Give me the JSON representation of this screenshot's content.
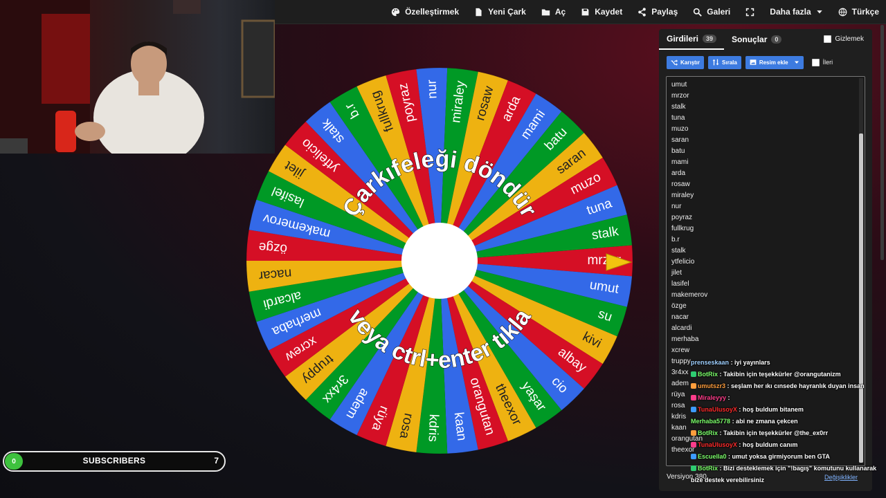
{
  "menu": [
    {
      "label": "Özelleştirmek",
      "icon": "palette-icon"
    },
    {
      "label": "Yeni Çark",
      "icon": "file-icon"
    },
    {
      "label": "Aç",
      "icon": "folder-icon"
    },
    {
      "label": "Kaydet",
      "icon": "save-icon"
    },
    {
      "label": "Paylaş",
      "icon": "share-icon"
    },
    {
      "label": "Galeri",
      "icon": "search-icon"
    },
    {
      "label": "",
      "icon": "fullscreen-icon"
    },
    {
      "label": "Daha fazla",
      "icon": "chevron-down-icon"
    },
    {
      "label": "Türkçe",
      "icon": "globe-icon"
    }
  ],
  "wheel": {
    "top_text": "Çarkıfeleği döndür",
    "bottom_text": "veya ctrl+enter tıkla",
    "pointer_color": "#f2c40f",
    "colors": [
      "#3369e8",
      "#d50f25",
      "#eeb211",
      "#009925"
    ],
    "segments": [
      "mrzor",
      "umut",
      "su",
      "kivi",
      "albay",
      "cio",
      "yaşar",
      "theexor",
      "orangutan",
      "kaan",
      "kdris",
      "rosa",
      "rüya",
      "adem",
      "3r4xx",
      "truppy",
      "xcrew",
      "merhaba",
      "alcardi",
      "nacar",
      "özge",
      "makemerov",
      "lasifel",
      "jilet",
      "ytfelicio",
      "stalk",
      "b.r",
      "fullkrug",
      "poyraz",
      "nur",
      "miraley",
      "rosaw",
      "arda",
      "mami",
      "batu",
      "saran",
      "muzo",
      "tuna",
      "stalk"
    ]
  },
  "panel": {
    "tab_entries": "Girdileri",
    "entries_count": "39",
    "tab_results": "Sonuçlar",
    "results_count": "0",
    "hide_label": "Gizlemek",
    "shuffle_label": "Karıştır",
    "sort_label": "Sırala",
    "add_image_label": "Resim ekle",
    "advanced_label": "İleri",
    "entries": [
      "umut",
      "mrzor",
      "stalk",
      "tuna",
      "muzo",
      "saran",
      "batu",
      "mami",
      "arda",
      "rosaw",
      "miraley",
      "nur",
      "poyraz",
      "fullkrug",
      "b.r",
      "stalk",
      "ytfelicio",
      "jilet",
      "lasifel",
      "makemerov",
      "özge",
      "nacar",
      "alcardi",
      "merhaba",
      "xcrew",
      "truppy",
      "3r4xx",
      "adem",
      "rüya",
      "rosa",
      "kdris",
      "kaan",
      "orangutan",
      "theexor"
    ],
    "version": "Versiyon 380",
    "changes": "Değişiklikler"
  },
  "chat": [
    {
      "user": "prenseskaan",
      "color": "#9fd0ff",
      "text": ": iyi yayınlars"
    },
    {
      "user": "BotRix",
      "color": "#7cff6b",
      "text": ": Takibin için teşekkürler @orangutanizm"
    },
    {
      "user": "umutszr3",
      "color": "#ff9e3d",
      "text": ": seşlam her ıkı cınsede hayranlık duyan insan"
    },
    {
      "user": "Miraleyyy",
      "color": "#ff3d8b",
      "text": ":"
    },
    {
      "user": "TunaUlusoyX",
      "color": "#ff2a2a",
      "text": ": hoş buldum bitanem"
    },
    {
      "user": "Merhaba5778",
      "color": "#7cff6b",
      "text": ": abi ne zmana çekcen"
    },
    {
      "user": "BotRix",
      "color": "#7cff6b",
      "text": ": Takibin için teşekkürler @the_ex0rr"
    },
    {
      "user": "TunaUlusoyX",
      "color": "#ff2a2a",
      "text": ": hoş buldum canım"
    },
    {
      "user": "Escuella0",
      "color": "#7cff6b",
      "text": ": umut yoksa girmiyorum ben GTA"
    },
    {
      "user": "BotRix",
      "color": "#7cff6b",
      "text": ": Bizi desteklemek için \"!bagış\" komutunu kullanarak bize destek verebilirsiniz"
    }
  ],
  "subscribers": {
    "count": "0",
    "label": "SUBSCRIBERS",
    "goal": "7"
  }
}
